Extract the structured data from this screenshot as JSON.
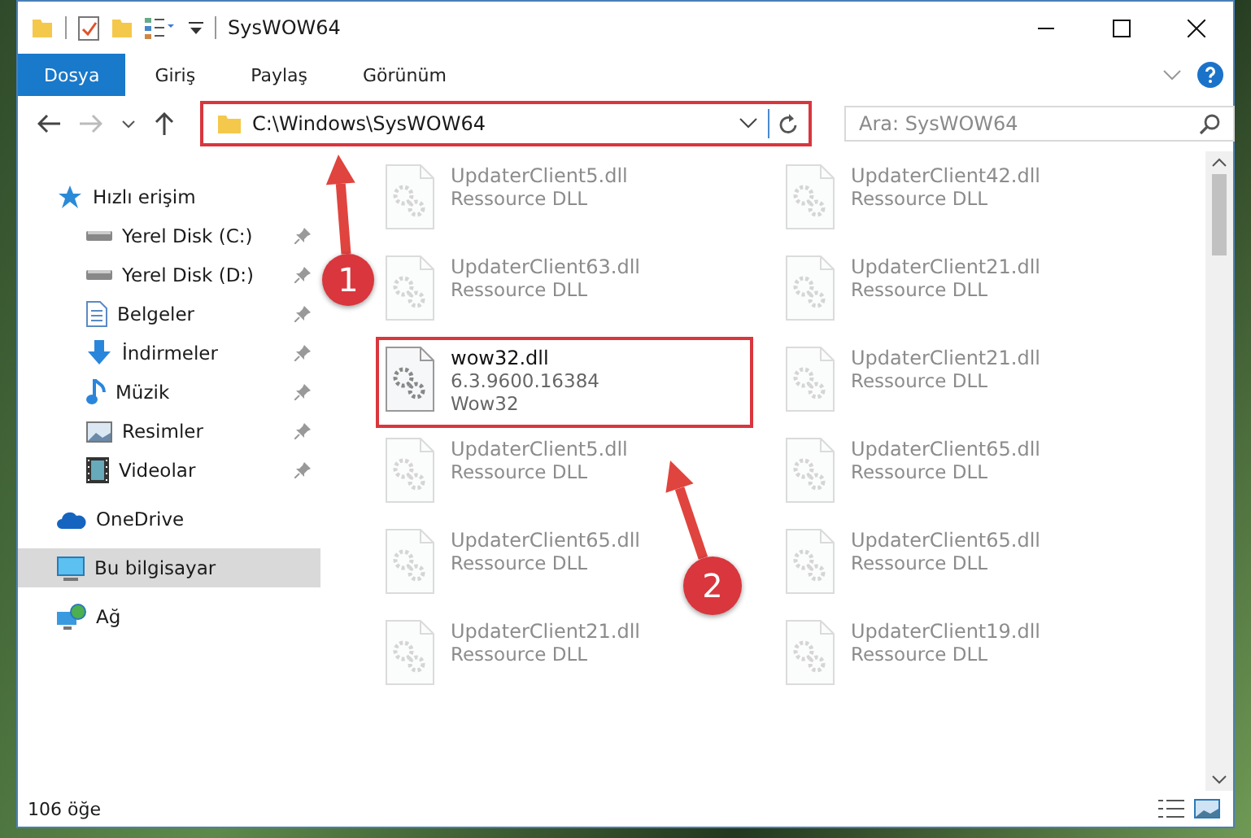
{
  "window": {
    "title": "SysWOW64"
  },
  "ribbon_tabs": [
    {
      "label": "Dosya",
      "selected": true
    },
    {
      "label": "Giriş",
      "selected": false
    },
    {
      "label": "Paylaş",
      "selected": false
    },
    {
      "label": "Görünüm",
      "selected": false
    }
  ],
  "address_bar": {
    "value": "C:\\Windows\\SysWOW64",
    "highlighted": true
  },
  "search": {
    "placeholder": "Ara: SysWOW64"
  },
  "sidebar": {
    "items": [
      {
        "label": "Hızlı erişim",
        "kind": "star",
        "pinned": false,
        "selected": false,
        "group": true
      },
      {
        "label": "Yerel Disk (C:)",
        "kind": "disk",
        "pinned": true,
        "selected": false,
        "group": false
      },
      {
        "label": "Yerel Disk (D:)",
        "kind": "disk",
        "pinned": true,
        "selected": false,
        "group": false
      },
      {
        "label": "Belgeler",
        "kind": "doc",
        "pinned": true,
        "selected": false,
        "group": false
      },
      {
        "label": "İndirmeler",
        "kind": "download",
        "pinned": true,
        "selected": false,
        "group": false
      },
      {
        "label": "Müzik",
        "kind": "music",
        "pinned": true,
        "selected": false,
        "group": false
      },
      {
        "label": "Resimler",
        "kind": "picture",
        "pinned": true,
        "selected": false,
        "group": false
      },
      {
        "label": "Videolar",
        "kind": "video",
        "pinned": true,
        "selected": false,
        "group": false
      },
      {
        "label": "OneDrive",
        "kind": "cloud",
        "pinned": false,
        "selected": false,
        "group": true
      },
      {
        "label": "Bu bilgisayar",
        "kind": "pc",
        "pinned": false,
        "selected": true,
        "group": true
      },
      {
        "label": "Ağ",
        "kind": "network",
        "pinned": false,
        "selected": false,
        "group": true
      }
    ]
  },
  "files": [
    {
      "lines": [
        "UpdaterClient5.dll",
        "Ressource DLL"
      ],
      "faded": true,
      "highlighted": false
    },
    {
      "lines": [
        "UpdaterClient42.dll",
        "Ressource DLL"
      ],
      "faded": true,
      "highlighted": false
    },
    {
      "lines": [
        "UpdaterClient63.dll",
        "Ressource DLL"
      ],
      "faded": true,
      "highlighted": false
    },
    {
      "lines": [
        "UpdaterClient21.dll",
        "Ressource DLL"
      ],
      "faded": true,
      "highlighted": false
    },
    {
      "lines": [
        "wow32.dll",
        "6.3.9600.16384",
        "Wow32"
      ],
      "faded": false,
      "highlighted": true
    },
    {
      "lines": [
        "UpdaterClient21.dll",
        "Ressource DLL"
      ],
      "faded": true,
      "highlighted": false
    },
    {
      "lines": [
        "UpdaterClient5.dll",
        "Ressource DLL"
      ],
      "faded": true,
      "highlighted": false
    },
    {
      "lines": [
        "UpdaterClient65.dll",
        "Ressource DLL"
      ],
      "faded": true,
      "highlighted": false
    },
    {
      "lines": [
        "UpdaterClient65.dll",
        "Ressource DLL"
      ],
      "faded": true,
      "highlighted": false
    },
    {
      "lines": [
        "UpdaterClient65.dll",
        "Ressource DLL"
      ],
      "faded": true,
      "highlighted": false
    },
    {
      "lines": [
        "UpdaterClient21.dll",
        "Ressource DLL"
      ],
      "faded": true,
      "highlighted": false
    },
    {
      "lines": [
        "UpdaterClient19.dll",
        "Ressource DLL"
      ],
      "faded": true,
      "highlighted": false
    }
  ],
  "status_bar": {
    "count": "106 öğe"
  },
  "annotations": [
    {
      "label": "1"
    },
    {
      "label": "2"
    }
  ]
}
